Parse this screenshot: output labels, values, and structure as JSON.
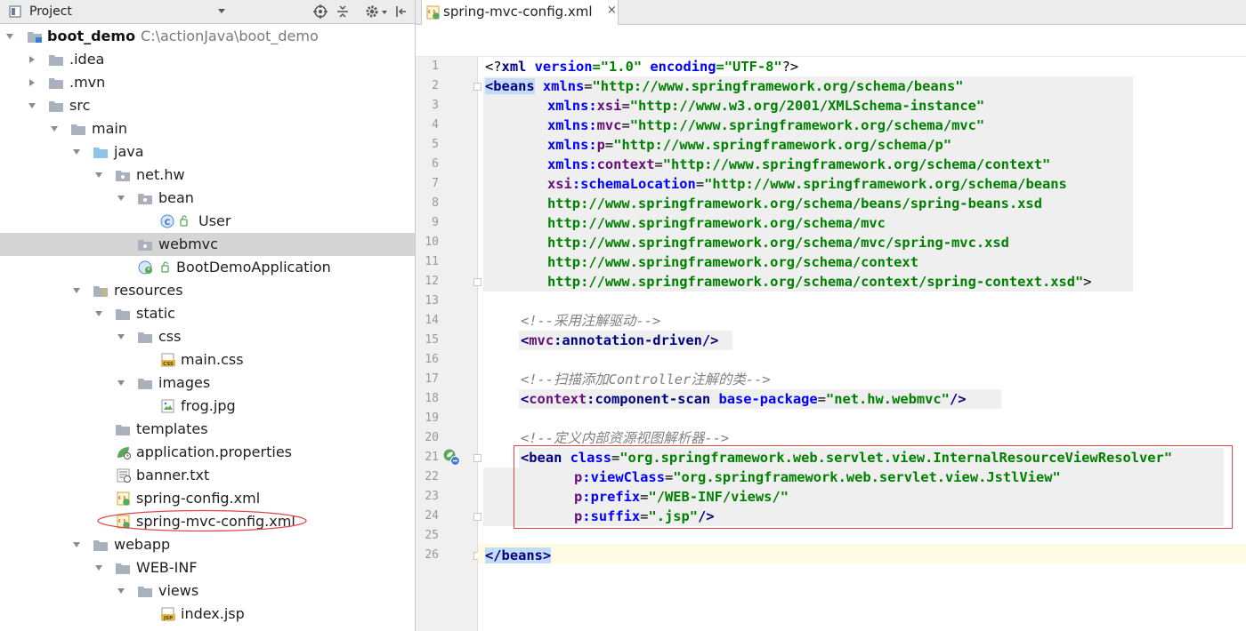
{
  "project_panel": {
    "title": "Project",
    "tree": [
      {
        "label": "boot_demo",
        "path": "C:\\actionJava\\boot_demo",
        "expanded": true,
        "icon": "module-folder-icon"
      },
      {
        "label": ".idea",
        "expanded": false,
        "icon": "folder-icon"
      },
      {
        "label": ".mvn",
        "expanded": false,
        "icon": "folder-icon"
      },
      {
        "label": "src",
        "expanded": true,
        "icon": "folder-icon"
      },
      {
        "label": "main",
        "expanded": true,
        "icon": "folder-icon"
      },
      {
        "label": "java",
        "expanded": true,
        "icon": "source-folder-icon"
      },
      {
        "label": "net.hw",
        "expanded": true,
        "icon": "package-icon"
      },
      {
        "label": "bean",
        "expanded": true,
        "icon": "package-icon"
      },
      {
        "label": "User",
        "icon": "class-icon"
      },
      {
        "label": "webmvc",
        "icon": "package-icon",
        "selected": true
      },
      {
        "label": "BootDemoApplication",
        "icon": "spring-boot-class-icon"
      },
      {
        "label": "resources",
        "expanded": true,
        "icon": "resources-folder-icon"
      },
      {
        "label": "static",
        "expanded": true,
        "icon": "folder-icon"
      },
      {
        "label": "css",
        "expanded": true,
        "icon": "folder-icon"
      },
      {
        "label": "main.css",
        "icon": "css-file-icon"
      },
      {
        "label": "images",
        "expanded": true,
        "icon": "folder-icon"
      },
      {
        "label": "frog.jpg",
        "icon": "image-file-icon"
      },
      {
        "label": "templates",
        "icon": "folder-icon"
      },
      {
        "label": "application.properties",
        "icon": "spring-properties-icon"
      },
      {
        "label": "banner.txt",
        "icon": "text-file-icon"
      },
      {
        "label": "spring-config.xml",
        "icon": "spring-xml-icon"
      },
      {
        "label": "spring-mvc-config.xml",
        "icon": "spring-xml-icon",
        "annotated": true
      },
      {
        "label": "webapp",
        "expanded": true,
        "icon": "folder-icon"
      },
      {
        "label": "WEB-INF",
        "expanded": true,
        "icon": "folder-icon"
      },
      {
        "label": "views",
        "expanded": true,
        "icon": "folder-icon"
      },
      {
        "label": "index.jsp",
        "icon": "jsp-file-icon"
      }
    ]
  },
  "editor": {
    "tab": {
      "label": "spring-mvc-config.xml",
      "close": "×"
    },
    "line_numbers": [
      "1",
      "2",
      "3",
      "4",
      "5",
      "6",
      "7",
      "8",
      "9",
      "10",
      "11",
      "12",
      "13",
      "14",
      "15",
      "16",
      "17",
      "18",
      "19",
      "20",
      "21",
      "22",
      "23",
      "24",
      "25",
      "26"
    ],
    "code": {
      "l1": [
        "<?",
        "xml ",
        "version",
        "=\"1.0\" ",
        "encoding",
        "=\"UTF-8\"",
        "?>"
      ],
      "l2": [
        "<",
        "beans",
        " ",
        "xmlns",
        "=",
        "\"http://www.springframework.org/schema/beans\""
      ],
      "l3": [
        "xmlns",
        ":",
        "xsi",
        "=",
        "\"http://www.w3.org/2001/XMLSchema-instance\""
      ],
      "l4": [
        "xmlns",
        ":",
        "mvc",
        "=",
        "\"http://www.springframework.org/schema/mvc\""
      ],
      "l5": [
        "xmlns",
        ":",
        "p",
        "=",
        "\"http://www.springframework.org/schema/p\""
      ],
      "l6": [
        "xmlns",
        ":",
        "context",
        "=",
        "\"http://www.springframework.org/schema/context\""
      ],
      "l7": [
        "xsi",
        ":",
        "schemaLocation",
        "=",
        "\"http://www.springframework.org/schema/beans"
      ],
      "l8": "http://www.springframework.org/schema/beans/spring-beans.xsd",
      "l9": "http://www.springframework.org/schema/mvc",
      "l10": "http://www.springframework.org/schema/mvc/spring-mvc.xsd",
      "l11": "http://www.springframework.org/schema/context",
      "l12": [
        "http://www.springframework.org/schema/context/spring-context.xsd\"",
        ">"
      ],
      "l14": "<!--采用注解驱动-->",
      "l15": [
        "<",
        "mvc",
        ":",
        "annotation-driven",
        "/>"
      ],
      "l17": "<!--扫描添加Controller注解的类-->",
      "l18": [
        "<",
        "context",
        ":",
        "component-scan",
        " ",
        "base-package",
        "=",
        "\"net.hw.webmvc\"",
        "/>"
      ],
      "l20": "<!--定义内部资源视图解析器-->",
      "l21": [
        "<",
        "bean",
        " ",
        "class",
        "=",
        "\"org.springframework.web.servlet.view.InternalResourceViewResolver\""
      ],
      "l22": [
        "p",
        ":",
        "viewClass",
        "=",
        "\"org.springframework.web.servlet.view.JstlView\""
      ],
      "l23": [
        "p",
        ":",
        "prefix",
        "=",
        "\"/WEB-INF/views/\""
      ],
      "l24": [
        "p",
        ":",
        "suffix",
        "=",
        "\".jsp\"",
        "/>"
      ],
      "l26": [
        "</",
        "beans",
        ">"
      ]
    }
  },
  "colors": {
    "tag": "#000080",
    "attribute": "#0000ff",
    "namespace": "#660e7a",
    "value": "#008000",
    "comment": "#808080",
    "annotation": "#e0474c",
    "selected_row": "#d5d5d5",
    "caret_line": "#fffae3"
  }
}
